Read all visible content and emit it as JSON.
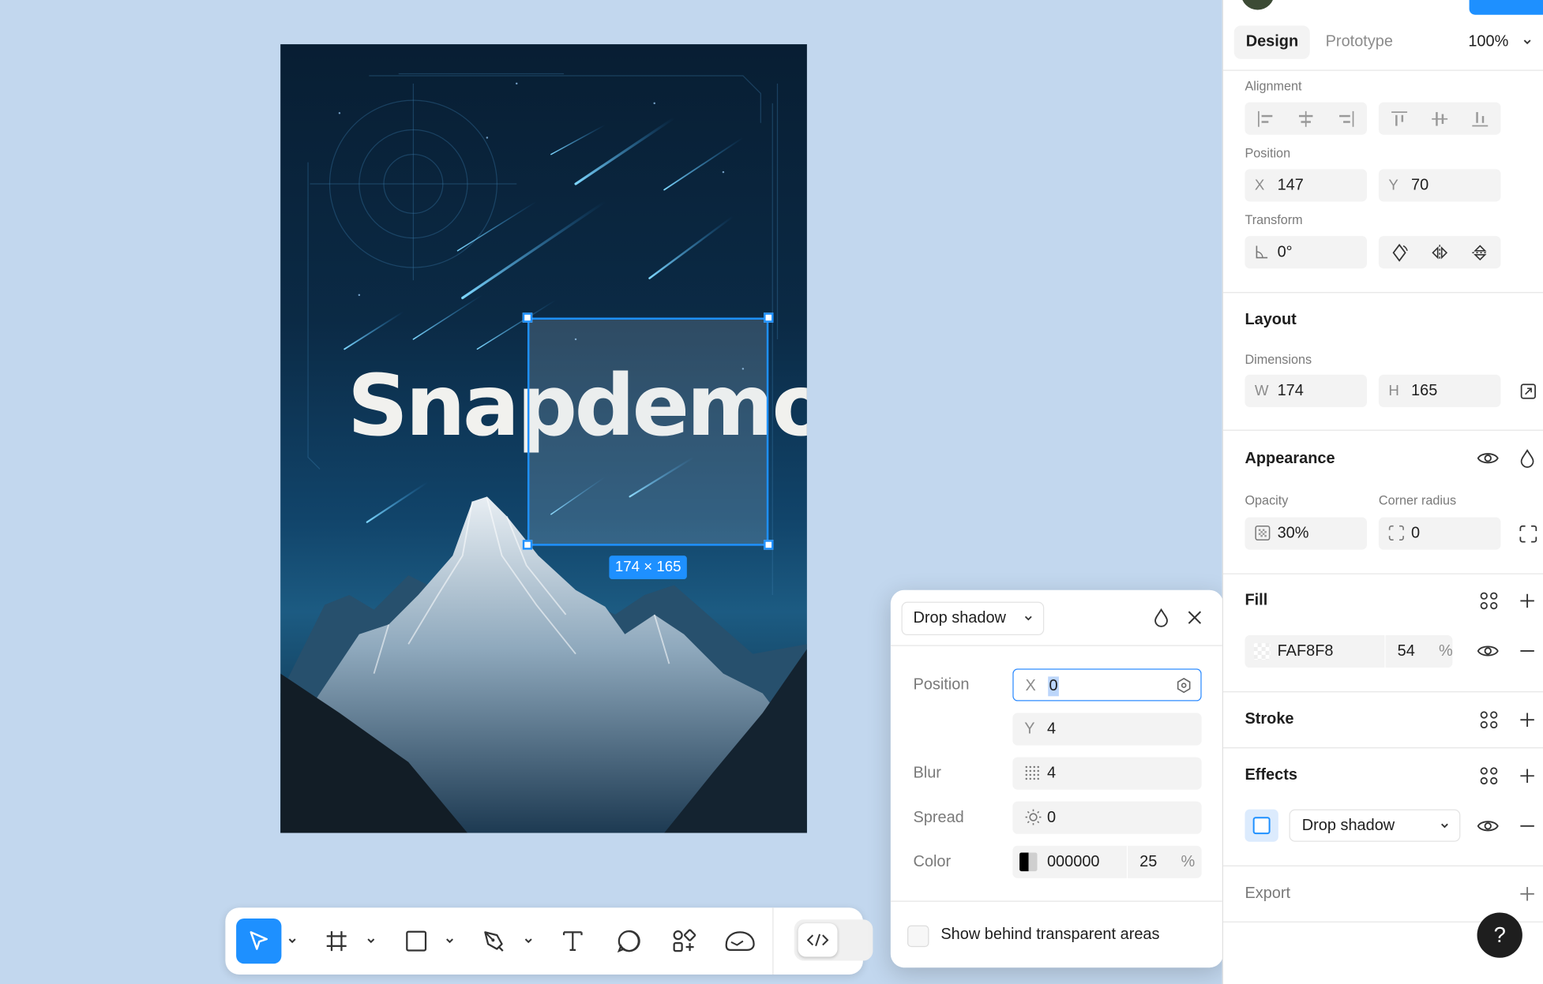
{
  "canvas": {
    "poster_title": "Snapdemo",
    "selection_size": "174 × 165"
  },
  "toolbar": {
    "tools": [
      "move",
      "frame",
      "rectangle",
      "pen",
      "text",
      "comment",
      "components",
      "actions"
    ],
    "code_toggle": "dev-mode"
  },
  "popover": {
    "effect_type": "Drop shadow",
    "position_label": "Position",
    "x_prefix": "X",
    "x_value": "0",
    "y_prefix": "Y",
    "y_value": "4",
    "blur_label": "Blur",
    "blur_value": "4",
    "spread_label": "Spread",
    "spread_value": "0",
    "color_label": "Color",
    "color_hex": "000000",
    "color_opacity": "25",
    "percent": "%",
    "show_behind_label": "Show behind transparent areas"
  },
  "panel": {
    "tabs": {
      "design": "Design",
      "prototype": "Prototype"
    },
    "zoom": "100%",
    "alignment_label": "Alignment",
    "position_label": "Position",
    "x_prefix": "X",
    "x_value": "147",
    "y_prefix": "Y",
    "y_value": "70",
    "transform_label": "Transform",
    "rotation_value": "0°",
    "layout_title": "Layout",
    "dimensions_label": "Dimensions",
    "w_prefix": "W",
    "w_value": "174",
    "h_prefix": "H",
    "h_value": "165",
    "appearance_title": "Appearance",
    "opacity_label": "Opacity",
    "opacity_value": "30%",
    "corner_radius_label": "Corner radius",
    "corner_radius_value": "0",
    "fill_title": "Fill",
    "fill_hex": "FAF8F8",
    "fill_opacity": "54",
    "percent": "%",
    "stroke_title": "Stroke",
    "effects_title": "Effects",
    "effect_name": "Drop shadow",
    "export_title": "Export",
    "help": "?"
  },
  "colors": {
    "accent": "#1e90ff",
    "canvas_bg": "#c2d7ee"
  }
}
